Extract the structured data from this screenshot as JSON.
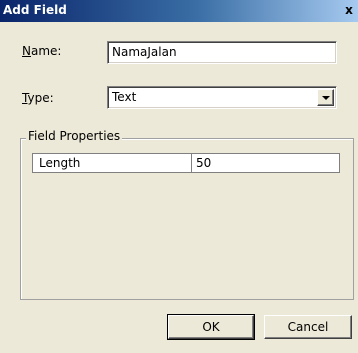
{
  "window": {
    "title": "Add Field",
    "close_glyph": "x"
  },
  "form": {
    "name_label_ul": "N",
    "name_label_rest": "ame:",
    "name_value": "NamaJalan",
    "type_label_ul": "T",
    "type_label_rest": "ype:",
    "type_value": "Text"
  },
  "field_properties": {
    "legend": "Field Properties",
    "rows": [
      {
        "property": "Length",
        "value": "50"
      }
    ]
  },
  "buttons": {
    "ok": "OK",
    "cancel": "Cancel"
  },
  "icons": {
    "dropdown": "chevron-down-icon"
  }
}
